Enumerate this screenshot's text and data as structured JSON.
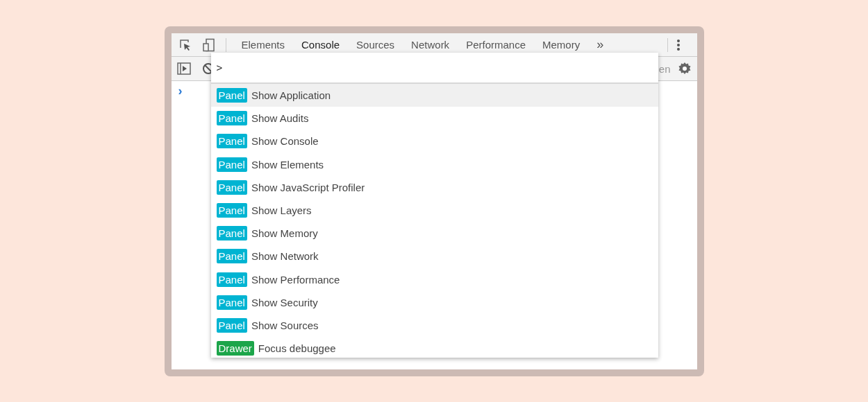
{
  "toolbar": {
    "tabs": [
      {
        "label": "Elements",
        "selected": false
      },
      {
        "label": "Console",
        "selected": true
      },
      {
        "label": "Sources",
        "selected": false
      },
      {
        "label": "Network",
        "selected": false
      },
      {
        "label": "Performance",
        "selected": false
      },
      {
        "label": "Memory",
        "selected": false
      }
    ],
    "overflow": "»"
  },
  "console_bar": {
    "partial_text": "en"
  },
  "prompt": "›",
  "command_menu": {
    "query": ">",
    "items": [
      {
        "category": "Panel",
        "color": "#00b4d2",
        "label": "Show Application",
        "selected": true
      },
      {
        "category": "Panel",
        "color": "#00b4d2",
        "label": "Show Audits",
        "selected": false
      },
      {
        "category": "Panel",
        "color": "#00b4d2",
        "label": "Show Console",
        "selected": false
      },
      {
        "category": "Panel",
        "color": "#00b4d2",
        "label": "Show Elements",
        "selected": false
      },
      {
        "category": "Panel",
        "color": "#00b4d2",
        "label": "Show JavaScript Profiler",
        "selected": false
      },
      {
        "category": "Panel",
        "color": "#00b4d2",
        "label": "Show Layers",
        "selected": false
      },
      {
        "category": "Panel",
        "color": "#00b4d2",
        "label": "Show Memory",
        "selected": false
      },
      {
        "category": "Panel",
        "color": "#00b4d2",
        "label": "Show Network",
        "selected": false
      },
      {
        "category": "Panel",
        "color": "#00b4d2",
        "label": "Show Performance",
        "selected": false
      },
      {
        "category": "Panel",
        "color": "#00b4d2",
        "label": "Show Security",
        "selected": false
      },
      {
        "category": "Panel",
        "color": "#00b4d2",
        "label": "Show Sources",
        "selected": false
      },
      {
        "category": "Drawer",
        "color": "#1ca54a",
        "label": "Focus debuggee",
        "selected": false
      }
    ]
  }
}
